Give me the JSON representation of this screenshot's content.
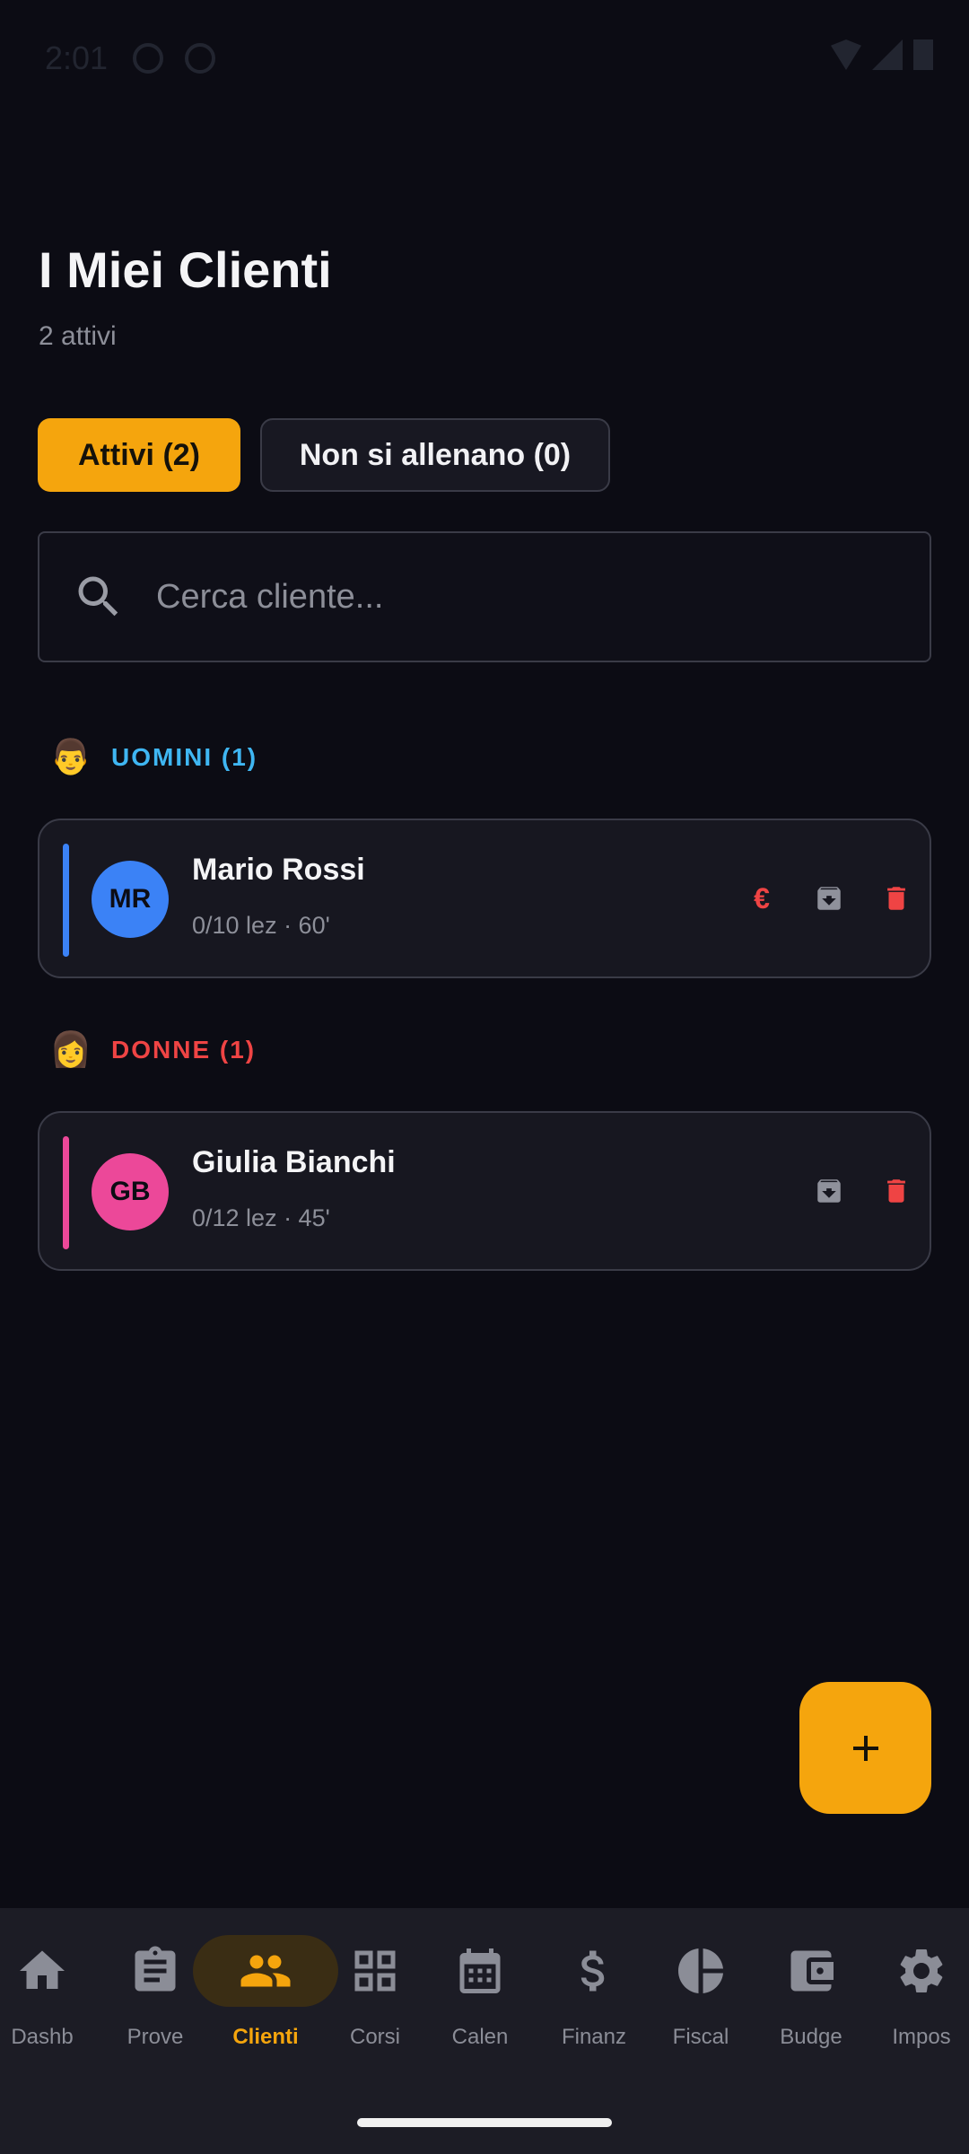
{
  "status_bar": {
    "time": "2:01"
  },
  "header": {
    "title": "I Miei Clienti",
    "subtitle": "2 attivi"
  },
  "tabs": [
    {
      "label": "Attivi (2)",
      "active": true
    },
    {
      "label": "Non si allenano (0)",
      "active": false
    }
  ],
  "search": {
    "placeholder": "Cerca cliente...",
    "value": ""
  },
  "sections": {
    "men": {
      "emoji": "👨",
      "label": "UOMINI (1)",
      "color": "#3fb6f2",
      "client": {
        "initials": "MR",
        "name": "Mario Rossi",
        "meta": "0/10 lez · 60'",
        "avatar_color": "#3b82f6",
        "payment_symbol": "€"
      }
    },
    "women": {
      "emoji": "👩",
      "label": "DONNE (1)",
      "color": "#ef4444",
      "client": {
        "initials": "GB",
        "name": "Giulia Bianchi",
        "meta": "0/12 lez · 45'",
        "avatar_color": "#ec4899"
      }
    }
  },
  "nav": [
    {
      "label": "Dashb",
      "icon": "home-icon",
      "active": false
    },
    {
      "label": "Prove",
      "icon": "clipboard-icon",
      "active": false
    },
    {
      "label": "Clienti",
      "icon": "people-icon",
      "active": true
    },
    {
      "label": "Corsi",
      "icon": "grid-icon",
      "active": false
    },
    {
      "label": "Calen",
      "icon": "calendar-icon",
      "active": false
    },
    {
      "label": "Finanz",
      "icon": "dollar-icon",
      "active": false
    },
    {
      "label": "Fiscal",
      "icon": "pie-chart-icon",
      "active": false
    },
    {
      "label": "Budge",
      "icon": "wallet-icon",
      "active": false
    },
    {
      "label": "Impos",
      "icon": "gear-icon",
      "active": false
    }
  ],
  "colors": {
    "accent": "#f5a50d",
    "background": "#0c0c14",
    "danger": "#ef4444"
  }
}
